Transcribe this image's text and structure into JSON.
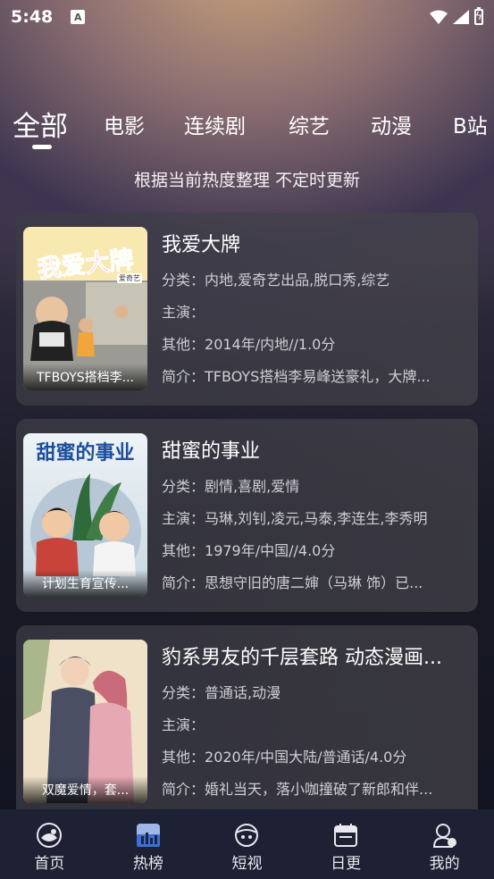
{
  "status_bar": {
    "time": "5:48",
    "notification_letter": "A"
  },
  "tabs": [
    {
      "label": "全部",
      "active": true
    },
    {
      "label": "电影",
      "active": false
    },
    {
      "label": "连续剧",
      "active": false
    },
    {
      "label": "综艺",
      "active": false
    },
    {
      "label": "动漫",
      "active": false
    },
    {
      "label": "B站",
      "active": false
    }
  ],
  "subtitle": "根据当前热度整理 不定时更新",
  "items": [
    {
      "title": "我爱大牌",
      "poster_caption": "TFBOYS搭档李...",
      "poster_title": "我爱大牌",
      "poster_badge": "爱奇艺",
      "category_label": "分类：",
      "category": "内地,爱奇艺出品,脱口秀,综艺",
      "cast_label": "主演：",
      "cast": "",
      "other_label": "其他：",
      "other": "2014年/内地//1.0分",
      "summary_label": "简介：",
      "summary": "TFBOYS搭档李易峰送豪礼，大牌..."
    },
    {
      "title": "甜蜜的事业",
      "poster_caption": "计划生育宣传...",
      "poster_title": "甜蜜的事业",
      "category_label": "分类：",
      "category": "剧情,喜剧,爱情",
      "cast_label": "主演：",
      "cast": "马琳,刘钊,凌元,马泰,李连生,李秀明",
      "other_label": "其他：",
      "other": "1979年/中国//4.0分",
      "summary_label": "简介：",
      "summary": "思想守旧的唐二婶（马琳 饰）已..."
    },
    {
      "title": "豹系男友的千层套路 动态漫画...",
      "poster_caption": "双魔爱情，套...",
      "category_label": "分类：",
      "category": "普通话,动漫",
      "cast_label": "主演：",
      "cast": "",
      "other_label": "其他：",
      "other": "2020年/中国大陆/普通话/4.0分",
      "summary_label": "简介：",
      "summary": "婚礼当天，落小咖撞破了新郎和伴..."
    }
  ],
  "bottom_nav": [
    {
      "label": "首页",
      "icon": "home-icon"
    },
    {
      "label": "热榜",
      "icon": "chart-icon"
    },
    {
      "label": "短视",
      "icon": "video-icon"
    },
    {
      "label": "日更",
      "icon": "calendar-icon"
    },
    {
      "label": "我的",
      "icon": "profile-icon"
    }
  ]
}
